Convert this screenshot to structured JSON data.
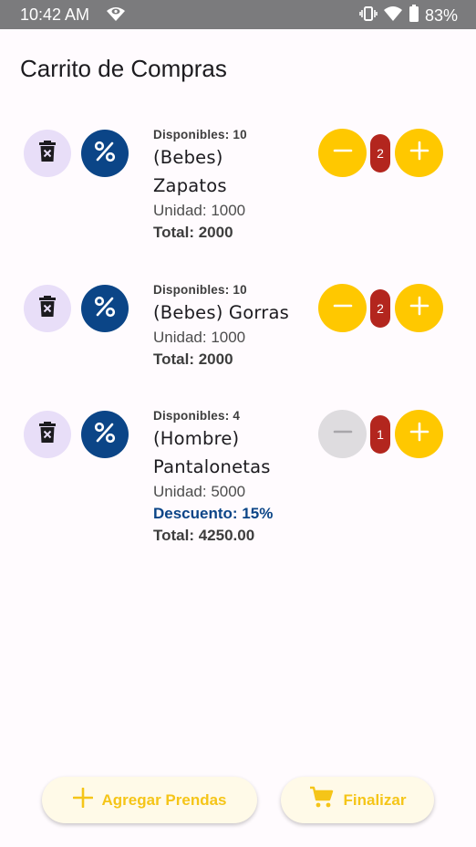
{
  "status_bar": {
    "time": "10:42 AM",
    "battery": "83%"
  },
  "title": "Carrito de Compras",
  "items": [
    {
      "available": "Disponibles: 10",
      "name_line1": "(Bebes)",
      "name_line2": "Zapatos",
      "unit": "Unidad: 1000",
      "discount": "",
      "total": "Total: 2000",
      "quantity": "2",
      "minus_enabled": true
    },
    {
      "available": "Disponibles: 10",
      "name_line1": "(Bebes) Gorras",
      "name_line2": "",
      "unit": "Unidad: 1000",
      "discount": "",
      "total": "Total: 2000",
      "quantity": "2",
      "minus_enabled": true
    },
    {
      "available": "Disponibles: 4",
      "name_line1": "(Hombre)",
      "name_line2": "Pantalonetas",
      "unit": "Unidad: 5000",
      "discount": "Descuento: 15%",
      "total": "Total: 4250.00",
      "quantity": "1",
      "minus_enabled": false
    }
  ],
  "actions": {
    "add_label": "Agregar Prendas",
    "finish_label": "Finalizar"
  },
  "colors": {
    "accent": "#ffc800",
    "discount_blue": "#0b4587",
    "badge_red": "#b3261e",
    "delete_bg": "#e8def8"
  },
  "icons": [
    "delete-icon",
    "percent-icon",
    "minus-icon",
    "plus-icon",
    "cart-icon"
  ]
}
